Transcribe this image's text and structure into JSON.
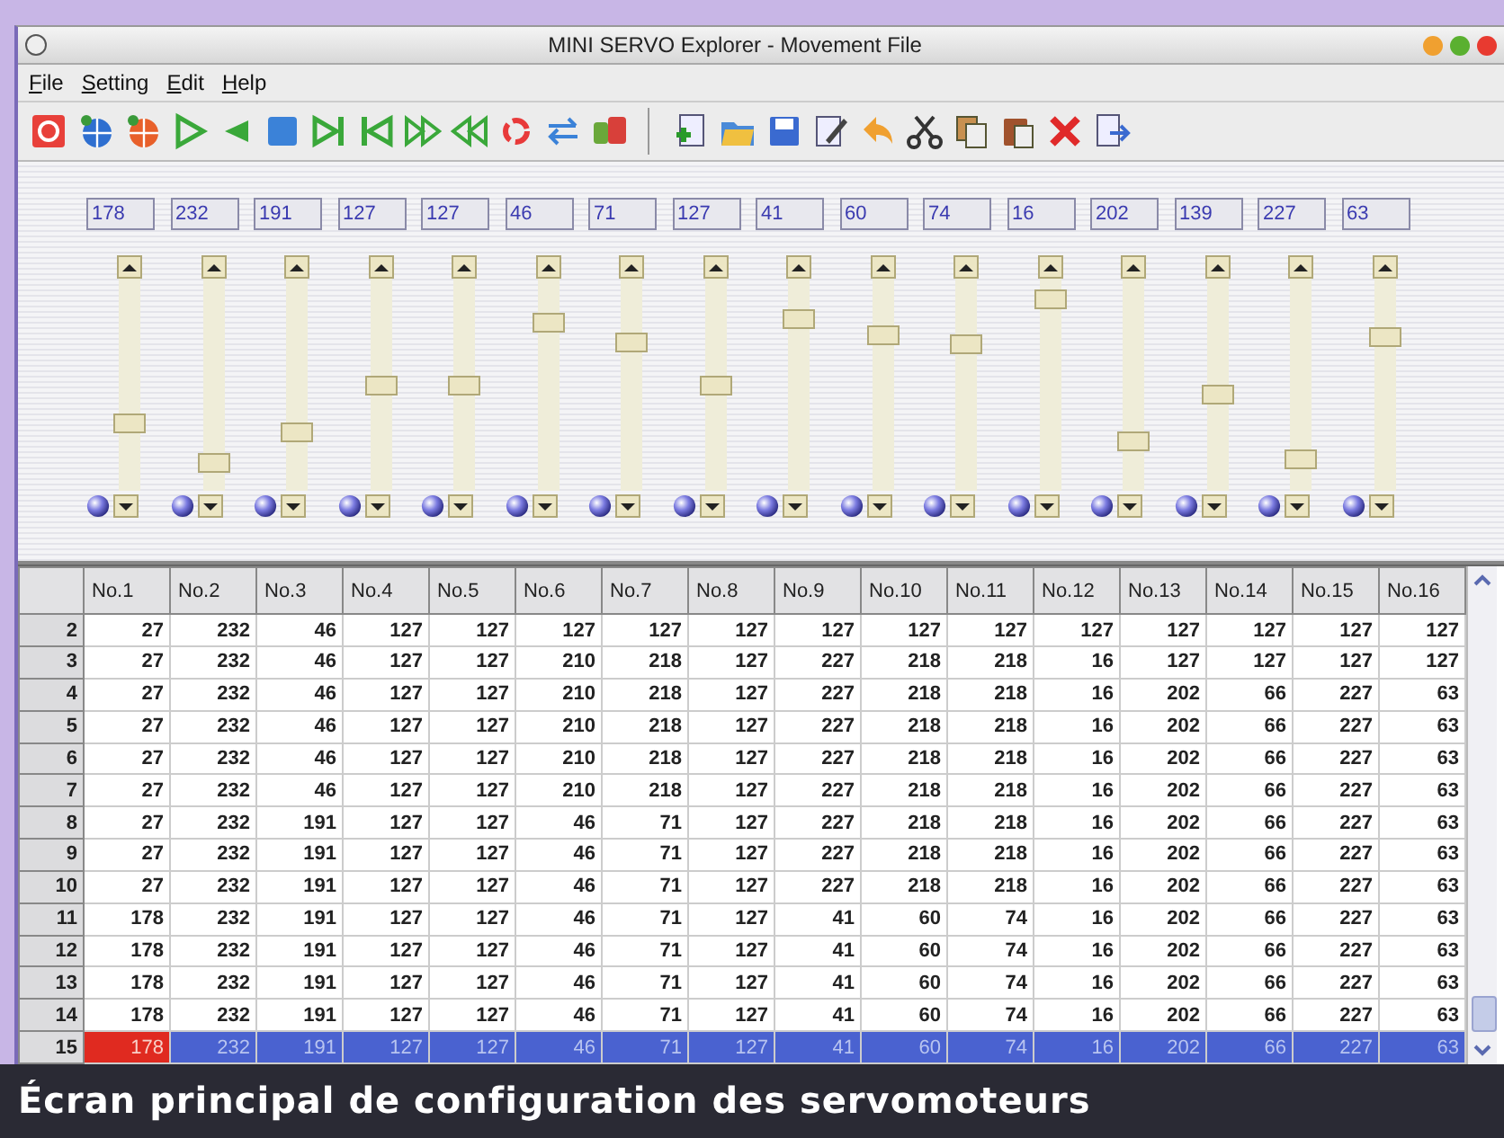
{
  "window": {
    "title": "MINI SERVO Explorer - Movement File"
  },
  "menu": [
    "File",
    "Setting",
    "Edit",
    "Help"
  ],
  "sliders": [
    {
      "value": "178",
      "level": 0.3
    },
    {
      "value": "232",
      "level": 0.09
    },
    {
      "value": "191",
      "level": 0.25
    },
    {
      "value": "127",
      "level": 0.5
    },
    {
      "value": "127",
      "level": 0.5
    },
    {
      "value": "46",
      "level": 0.82
    },
    {
      "value": "71",
      "level": 0.72
    },
    {
      "value": "127",
      "level": 0.5
    },
    {
      "value": "41",
      "level": 0.84
    },
    {
      "value": "60",
      "level": 0.76
    },
    {
      "value": "74",
      "level": 0.71
    },
    {
      "value": "16",
      "level": 0.94
    },
    {
      "value": "202",
      "level": 0.21
    },
    {
      "value": "139",
      "level": 0.45
    },
    {
      "value": "227",
      "level": 0.11
    },
    {
      "value": "63",
      "level": 0.75
    }
  ],
  "table": {
    "columns": [
      "No.1",
      "No.2",
      "No.3",
      "No.4",
      "No.5",
      "No.6",
      "No.7",
      "No.8",
      "No.9",
      "No.10",
      "No.11",
      "No.12",
      "No.13",
      "No.14",
      "No.15",
      "No.16"
    ],
    "rows": [
      {
        "header": "2",
        "selected": false,
        "focused_first_cell": false,
        "cells": [
          "27",
          "232",
          "46",
          "127",
          "127",
          "127",
          "127",
          "127",
          "127",
          "127",
          "127",
          "127",
          "127",
          "127",
          "127",
          "127"
        ]
      },
      {
        "header": "3",
        "selected": false,
        "focused_first_cell": false,
        "cells": [
          "27",
          "232",
          "46",
          "127",
          "127",
          "210",
          "218",
          "127",
          "227",
          "218",
          "218",
          "16",
          "127",
          "127",
          "127",
          "127"
        ]
      },
      {
        "header": "4",
        "selected": false,
        "focused_first_cell": false,
        "cells": [
          "27",
          "232",
          "46",
          "127",
          "127",
          "210",
          "218",
          "127",
          "227",
          "218",
          "218",
          "16",
          "202",
          "66",
          "227",
          "63"
        ]
      },
      {
        "header": "5",
        "selected": false,
        "focused_first_cell": false,
        "cells": [
          "27",
          "232",
          "46",
          "127",
          "127",
          "210",
          "218",
          "127",
          "227",
          "218",
          "218",
          "16",
          "202",
          "66",
          "227",
          "63"
        ]
      },
      {
        "header": "6",
        "selected": false,
        "focused_first_cell": false,
        "cells": [
          "27",
          "232",
          "46",
          "127",
          "127",
          "210",
          "218",
          "127",
          "227",
          "218",
          "218",
          "16",
          "202",
          "66",
          "227",
          "63"
        ]
      },
      {
        "header": "7",
        "selected": false,
        "focused_first_cell": false,
        "cells": [
          "27",
          "232",
          "46",
          "127",
          "127",
          "210",
          "218",
          "127",
          "227",
          "218",
          "218",
          "16",
          "202",
          "66",
          "227",
          "63"
        ]
      },
      {
        "header": "8",
        "selected": false,
        "focused_first_cell": false,
        "cells": [
          "27",
          "232",
          "191",
          "127",
          "127",
          "46",
          "71",
          "127",
          "227",
          "218",
          "218",
          "16",
          "202",
          "66",
          "227",
          "63"
        ]
      },
      {
        "header": "9",
        "selected": false,
        "focused_first_cell": false,
        "cells": [
          "27",
          "232",
          "191",
          "127",
          "127",
          "46",
          "71",
          "127",
          "227",
          "218",
          "218",
          "16",
          "202",
          "66",
          "227",
          "63"
        ]
      },
      {
        "header": "10",
        "selected": false,
        "focused_first_cell": false,
        "cells": [
          "27",
          "232",
          "191",
          "127",
          "127",
          "46",
          "71",
          "127",
          "227",
          "218",
          "218",
          "16",
          "202",
          "66",
          "227",
          "63"
        ]
      },
      {
        "header": "11",
        "selected": false,
        "focused_first_cell": false,
        "cells": [
          "178",
          "232",
          "191",
          "127",
          "127",
          "46",
          "71",
          "127",
          "41",
          "60",
          "74",
          "16",
          "202",
          "66",
          "227",
          "63"
        ]
      },
      {
        "header": "12",
        "selected": false,
        "focused_first_cell": false,
        "cells": [
          "178",
          "232",
          "191",
          "127",
          "127",
          "46",
          "71",
          "127",
          "41",
          "60",
          "74",
          "16",
          "202",
          "66",
          "227",
          "63"
        ]
      },
      {
        "header": "13",
        "selected": false,
        "focused_first_cell": false,
        "cells": [
          "178",
          "232",
          "191",
          "127",
          "127",
          "46",
          "71",
          "127",
          "41",
          "60",
          "74",
          "16",
          "202",
          "66",
          "227",
          "63"
        ]
      },
      {
        "header": "14",
        "selected": false,
        "focused_first_cell": false,
        "cells": [
          "178",
          "232",
          "191",
          "127",
          "127",
          "46",
          "71",
          "127",
          "41",
          "60",
          "74",
          "16",
          "202",
          "66",
          "227",
          "63"
        ]
      },
      {
        "header": "15",
        "selected": true,
        "focused_first_cell": true,
        "cells": [
          "178",
          "232",
          "191",
          "127",
          "127",
          "46",
          "71",
          "127",
          "41",
          "60",
          "74",
          "16",
          "202",
          "66",
          "227",
          "63"
        ]
      }
    ]
  },
  "caption": "Écran principal de configuration des servomoteurs"
}
